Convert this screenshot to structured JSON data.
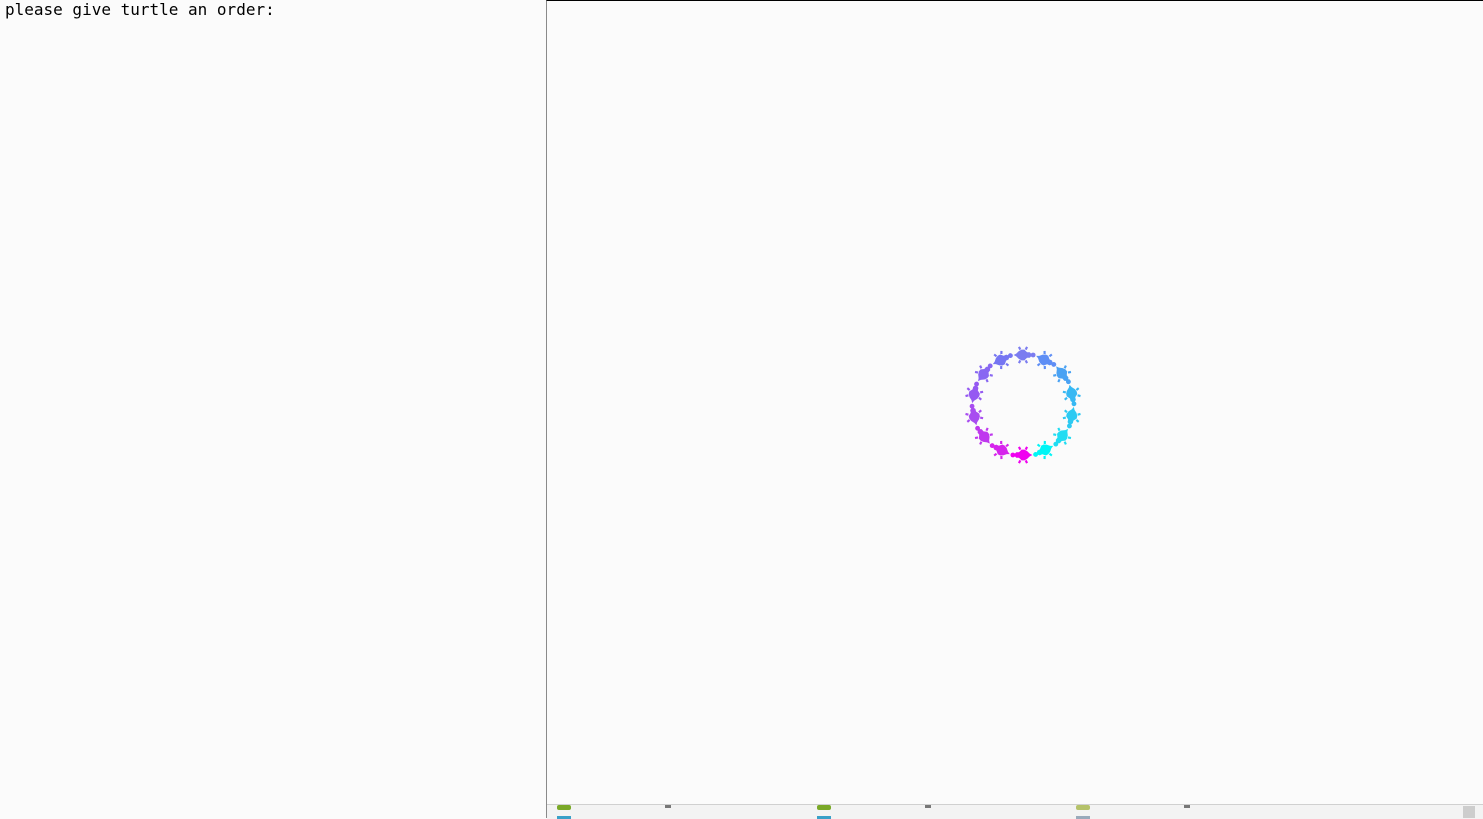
{
  "console": {
    "prompt_text": "please give turtle an order:"
  },
  "turtle_canvas": {
    "turtle_shape": "turtle-icon",
    "turtle_count": 14,
    "ring_colors": [
      "#7b7cf0",
      "#5e8ef5",
      "#4aa2f3",
      "#37b8f3",
      "#2dcaf2",
      "#21dcf2",
      "#00f5f5",
      "#f000f0",
      "#d624ec",
      "#bf38ee",
      "#a84df0",
      "#9559f2",
      "#8867f2",
      "#7575f2"
    ]
  },
  "taskbar": {
    "items": [
      "turtle-app-icon",
      "turtle-app-icon",
      "turtle-app-icon"
    ]
  }
}
